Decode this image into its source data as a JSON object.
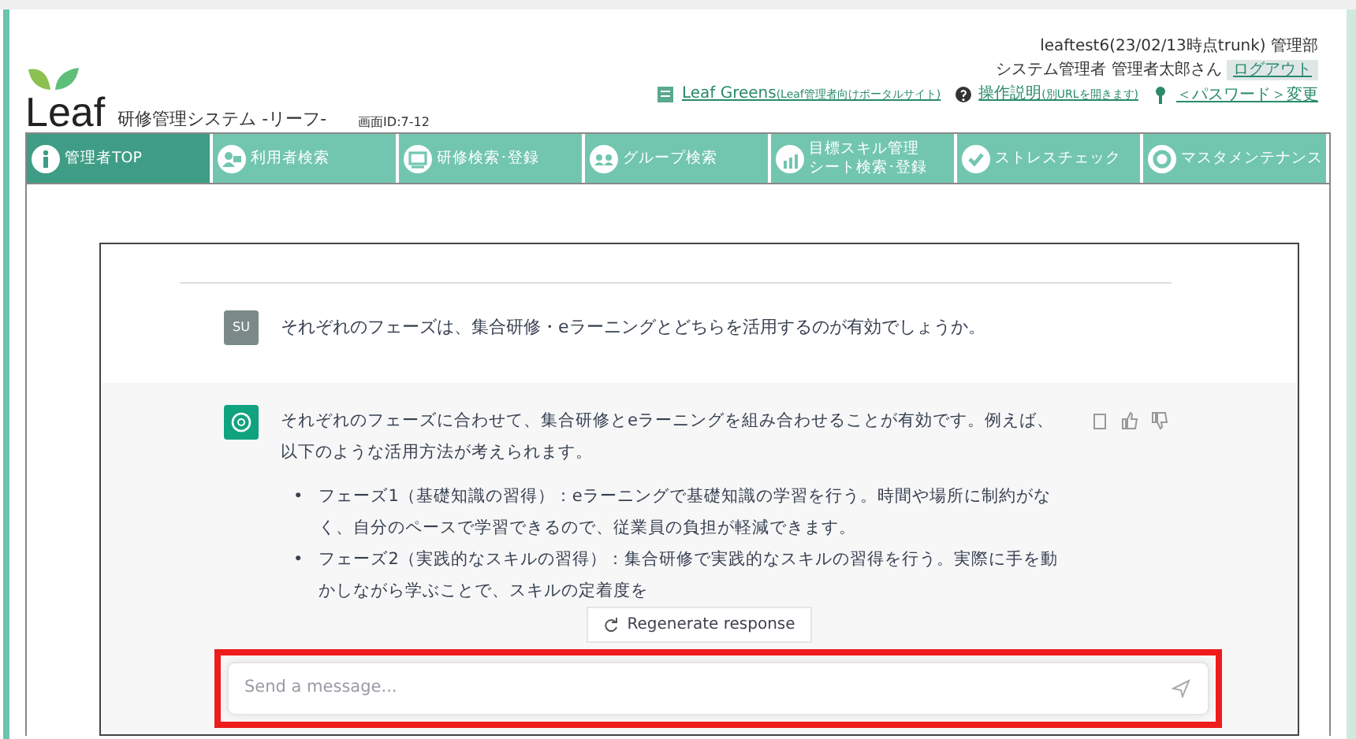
{
  "header": {
    "logo": "Leaf",
    "system_title": "研修管理システム -リーフ-",
    "screen_id": "画面ID:7-12",
    "user_info": [
      "leaftest6(23/02/13時点trunk) 管理部",
      "システム管理者 管理者太郎さん"
    ],
    "logout": "ログアウト",
    "links": [
      {
        "kind": "portal",
        "label": "Leaf Greens",
        "note": "(Leaf管理者向けポータルサイト)"
      },
      {
        "kind": "help",
        "label": "操作説明",
        "note": "(別URLを開きます)"
      },
      {
        "kind": "password",
        "label": "＜パスワード＞変更"
      }
    ]
  },
  "nav": [
    {
      "kind": "info",
      "label": "管理者TOP",
      "selected": true
    },
    {
      "kind": "user",
      "label": "利用者検索",
      "selected": false
    },
    {
      "kind": "monitor",
      "label": "研修検索･登録",
      "selected": false
    },
    {
      "kind": "group",
      "label": "グループ検索",
      "selected": false
    },
    {
      "kind": "chart",
      "lines": [
        "目標スキル管理",
        "シート検索･登録"
      ],
      "selected": false
    },
    {
      "kind": "check",
      "label": "ストレスチェック",
      "selected": false
    },
    {
      "kind": "gear",
      "label": "マスタメンテナンス",
      "selected": false
    }
  ],
  "chat": {
    "messages": [
      {
        "kind": "user",
        "avatar": "SU",
        "text": "それぞれのフェーズは、集合研修・eラーニングとどちらを活用するのが有効でしょうか。"
      },
      {
        "kind": "assistant",
        "text": "それぞれのフェーズに合わせて、集合研修とeラーニングを組み合わせることが有効です。例えば、以下のような活用方法が考えられます。",
        "bullets": [
          {
            "marker": "•",
            "text": "フェーズ1（基礎知識の習得）：eラーニングで基礎知識の学習を行う。時間や場所に制約がなく、自分のペースで学習できるので、従業員の負担が軽減できます。"
          },
          {
            "marker": "•",
            "text": "フェーズ2（実践的なスキルの習得）：集合研修で実践的なスキルの習得を行う。実際に手を動かしながら学ぶことで、スキルの定着度を"
          }
        ]
      }
    ],
    "regenerate": "Regenerate response",
    "input": {
      "placeholder": "Send a message...",
      "highlighted": true
    }
  }
}
